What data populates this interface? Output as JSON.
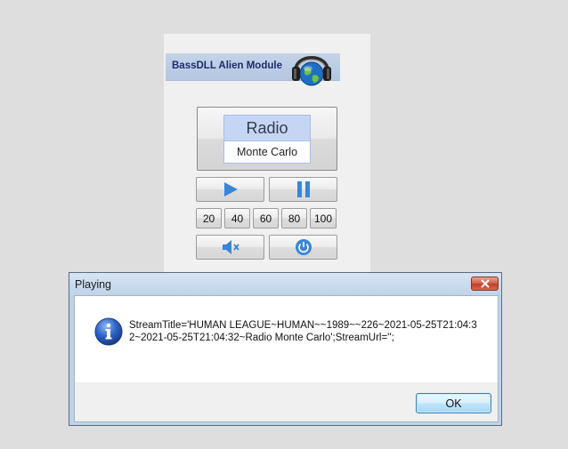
{
  "app": {
    "banner_title": "BassDLL Alien Module",
    "display": {
      "mode": "Radio",
      "station": "Monte Carlo"
    },
    "volume_presets": [
      "20",
      "40",
      "60",
      "80",
      "100"
    ],
    "icons": {
      "logo": "headphones-globe-icon",
      "play": "play-icon",
      "pause": "pause-icon",
      "mute": "mute-speaker-icon",
      "power": "power-icon"
    },
    "accent_color": "#3a86d6"
  },
  "dialog": {
    "title": "Playing",
    "message": "StreamTitle='HUMAN LEAGUE~HUMAN~~1989~~226~2021-05-25T21:04:32~2021-05-25T21:04:32~Radio Monte Carlo';StreamUrl='';",
    "ok_label": "OK",
    "icon": "information-icon",
    "close_icon": "close-icon"
  }
}
